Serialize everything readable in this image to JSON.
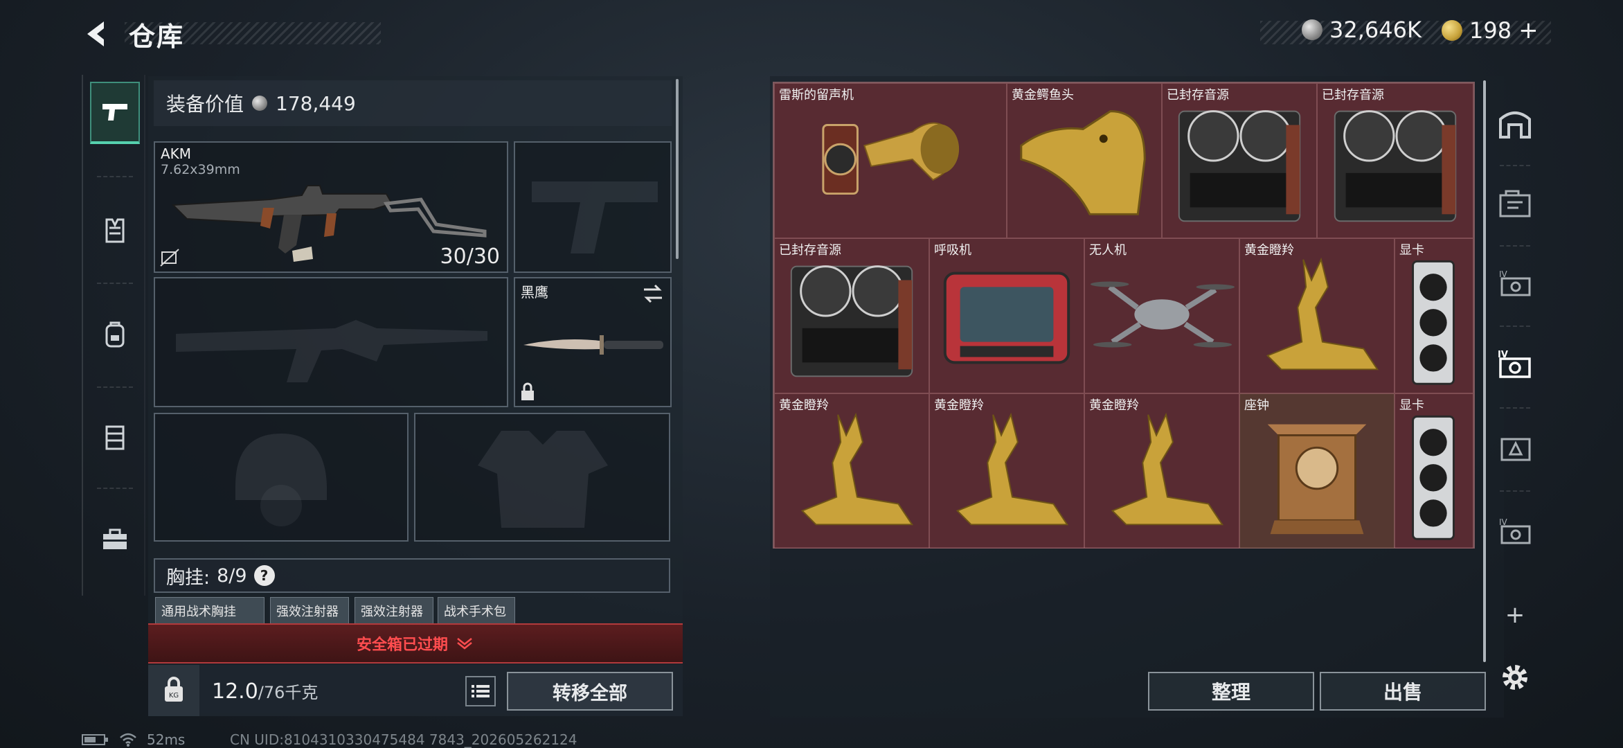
{
  "header": {
    "title": "仓库",
    "currency_silver": "32,646K",
    "currency_gold": "198",
    "add_label": "+"
  },
  "equipment": {
    "value_label": "装备价值",
    "value": "178,449",
    "primary": {
      "name": "AKM",
      "caliber": "7.62x39mm",
      "ammo": "30/30"
    },
    "melee": {
      "name": "黑鹰"
    },
    "rig_label": "胸挂:",
    "rig_count": "8/9",
    "rig_help": "?",
    "rig_items": [
      "通用战术胸挂",
      "强效注射器",
      "强效注射器",
      "战术手术包"
    ],
    "safebox_status": "安全箱已过期",
    "weight_current": "12.0",
    "weight_max": "/76千克",
    "transfer_all": "转移全部"
  },
  "storage": {
    "items": [
      "雷斯的留声机",
      "黄金鳄鱼头",
      "已封存音源",
      "已封存音源",
      "已封存音源",
      "呼吸机",
      "无人机",
      "黄金瞪羚",
      "显卡",
      "黄金瞪羚",
      "黄金瞪羚",
      "黄金瞪羚",
      "座钟",
      "显卡"
    ],
    "sort": "整理",
    "sell": "出售"
  },
  "right_rail": {
    "add": "+"
  },
  "status": {
    "ping": "52ms",
    "uid": "CN UID:8104310330475484 7843_202605262124"
  },
  "colors": {
    "accent": "#56d1ae",
    "grid_bg": "#4b2a30",
    "alert": "#ff4d4f"
  }
}
